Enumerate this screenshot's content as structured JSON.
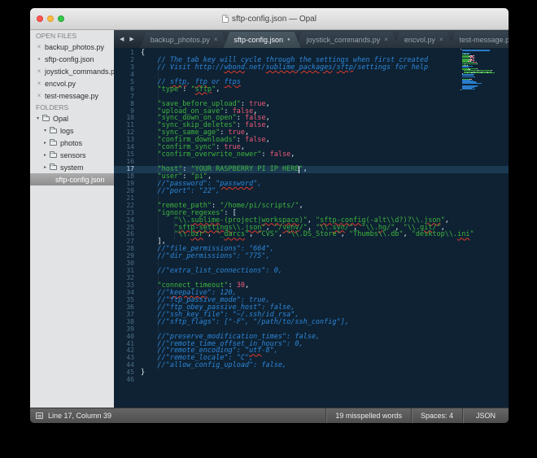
{
  "window": {
    "title": "sftp-config.json — Opal"
  },
  "icons": {
    "back": "◀",
    "forward": "▶",
    "overflow": "▼",
    "close": "×",
    "modified": "●",
    "expanded": "▾",
    "collapsed": "▸"
  },
  "sidebar": {
    "open_files_header": "OPEN FILES",
    "open_files": [
      {
        "name": "backup_photos.py",
        "modified": false
      },
      {
        "name": "sftp-config.json",
        "modified": true
      },
      {
        "name": "joystick_commands.py",
        "modified": false
      },
      {
        "name": "encvol.py",
        "modified": false
      },
      {
        "name": "test-message.py",
        "modified": false
      }
    ],
    "folders_header": "FOLDERS",
    "tree": [
      {
        "label": "Opal",
        "kind": "folder",
        "depth": 0,
        "expanded": true,
        "selected": false
      },
      {
        "label": "logs",
        "kind": "folder",
        "depth": 1,
        "expanded": true,
        "selected": false
      },
      {
        "label": "photos",
        "kind": "folder",
        "depth": 1,
        "expanded": false,
        "selected": false
      },
      {
        "label": "sensors",
        "kind": "folder",
        "depth": 1,
        "expanded": false,
        "selected": false
      },
      {
        "label": "system",
        "kind": "folder",
        "depth": 1,
        "expanded": false,
        "selected": false
      },
      {
        "label": "sftp-config.json",
        "kind": "file",
        "depth": 1,
        "expanded": false,
        "selected": true
      }
    ]
  },
  "tabs": [
    {
      "label": "backup_photos.py",
      "active": false,
      "modified": false
    },
    {
      "label": "sftp-config.json",
      "active": true,
      "modified": true
    },
    {
      "label": "joystick_commands.py",
      "active": false,
      "modified": false
    },
    {
      "label": "encvol.py",
      "active": false,
      "modified": false
    },
    {
      "label": "test-message.py",
      "active": false,
      "modified": false
    }
  ],
  "editor": {
    "active_line": 17,
    "cursor": {
      "line": 17,
      "column": 39
    },
    "lines": [
      [
        [
          "p",
          "{"
        ]
      ],
      [
        [
          "c",
          "    // The tab key will cycle through the settings when first created"
        ]
      ],
      [
        [
          "c",
          "    // Visit http://"
        ],
        [
          "cm",
          "wbond"
        ],
        [
          "c",
          ".net/"
        ],
        [
          "cm",
          "sublime_packages"
        ],
        [
          "c",
          "/"
        ],
        [
          "cm",
          "sftp"
        ],
        [
          "c",
          "/settings for help"
        ]
      ],
      [],
      [
        [
          "c",
          "    // "
        ],
        [
          "cm",
          "sftp"
        ],
        [
          "c",
          ", "
        ],
        [
          "cm",
          "ftp"
        ],
        [
          "c",
          " or "
        ],
        [
          "cm",
          "ftps"
        ]
      ],
      [
        [
          "p",
          "    "
        ],
        [
          "s",
          "\"type\""
        ],
        [
          "p",
          ": "
        ],
        [
          "s",
          "\""
        ],
        [
          "sm",
          "sftp"
        ],
        [
          "s",
          "\""
        ],
        [
          "p",
          ","
        ]
      ],
      [],
      [
        [
          "p",
          "    "
        ],
        [
          "s",
          "\"save_before_upload\""
        ],
        [
          "p",
          ": "
        ],
        [
          "v",
          "true"
        ],
        [
          "p",
          ","
        ]
      ],
      [
        [
          "p",
          "    "
        ],
        [
          "s",
          "\"upload_on_save\""
        ],
        [
          "p",
          ": "
        ],
        [
          "v",
          "false"
        ],
        [
          "p",
          ","
        ]
      ],
      [
        [
          "p",
          "    "
        ],
        [
          "s",
          "\"sync_down_on_open\""
        ],
        [
          "p",
          ": "
        ],
        [
          "v",
          "false"
        ],
        [
          "p",
          ","
        ]
      ],
      [
        [
          "p",
          "    "
        ],
        [
          "s",
          "\"sync_skip_deletes\""
        ],
        [
          "p",
          ": "
        ],
        [
          "v",
          "false"
        ],
        [
          "p",
          ","
        ]
      ],
      [
        [
          "p",
          "    "
        ],
        [
          "s",
          "\"sync_same_age\""
        ],
        [
          "p",
          ": "
        ],
        [
          "v",
          "true"
        ],
        [
          "p",
          ","
        ]
      ],
      [
        [
          "p",
          "    "
        ],
        [
          "s",
          "\"confirm_downloads\""
        ],
        [
          "p",
          ": "
        ],
        [
          "v",
          "false"
        ],
        [
          "p",
          ","
        ]
      ],
      [
        [
          "p",
          "    "
        ],
        [
          "s",
          "\"confirm_sync\""
        ],
        [
          "p",
          ": "
        ],
        [
          "v",
          "true"
        ],
        [
          "p",
          ","
        ]
      ],
      [
        [
          "p",
          "    "
        ],
        [
          "s",
          "\"confirm_overwrite_newer\""
        ],
        [
          "p",
          ": "
        ],
        [
          "v",
          "false"
        ],
        [
          "p",
          ","
        ]
      ],
      [],
      [
        [
          "p",
          "    "
        ],
        [
          "s",
          "\"host\""
        ],
        [
          "p",
          ": "
        ],
        [
          "s",
          "\"YOUR RASPBERRY PI IP HERE\""
        ],
        [
          "p",
          ","
        ]
      ],
      [
        [
          "p",
          "    "
        ],
        [
          "s",
          "\"user\""
        ],
        [
          "p",
          ": "
        ],
        [
          "s",
          "\"pi\""
        ],
        [
          "p",
          ","
        ]
      ],
      [
        [
          "c",
          "    //\"password\": \""
        ],
        [
          "cm",
          "password"
        ],
        [
          "c",
          "\","
        ]
      ],
      [
        [
          "c",
          "    //\"port\": \"22\","
        ]
      ],
      [],
      [
        [
          "p",
          "    "
        ],
        [
          "s",
          "\"remote_path\""
        ],
        [
          "p",
          ": "
        ],
        [
          "s",
          "\"/home/pi/scripts/\""
        ],
        [
          "p",
          ","
        ]
      ],
      [
        [
          "p",
          "    "
        ],
        [
          "s",
          "\"ignore_regexes\""
        ],
        [
          "p",
          ": ["
        ]
      ],
      [
        [
          "p",
          "        "
        ],
        [
          "s",
          "\"\\\\."
        ],
        [
          "sm",
          "sublime"
        ],
        [
          "s",
          "-(project|"
        ],
        [
          "sm",
          "workspace"
        ],
        [
          "s",
          ")\""
        ],
        [
          "p",
          ", "
        ],
        [
          "s",
          "\""
        ],
        [
          "sm",
          "sftp-config"
        ],
        [
          "s",
          "(-alt\\\\d?)?\\\\."
        ],
        [
          "sm",
          "json"
        ],
        [
          "s",
          "\""
        ],
        [
          "p",
          ","
        ]
      ],
      [
        [
          "p",
          "        "
        ],
        [
          "s",
          "\""
        ],
        [
          "sm",
          "sftp-settings"
        ],
        [
          "s",
          "\\\\."
        ],
        [
          "sm",
          "json"
        ],
        [
          "s",
          "\""
        ],
        [
          "p",
          ", "
        ],
        [
          "s",
          "\"/"
        ],
        [
          "sm",
          "venv"
        ],
        [
          "s",
          "/\""
        ],
        [
          "p",
          ", "
        ],
        [
          "s",
          "\"\\\\."
        ],
        [
          "sm",
          "svn"
        ],
        [
          "s",
          "/\""
        ],
        [
          "p",
          ", "
        ],
        [
          "s",
          "\"\\\\."
        ],
        [
          "sm",
          "hg"
        ],
        [
          "s",
          "/\""
        ],
        [
          "p",
          ", "
        ],
        [
          "s",
          "\"\\\\."
        ],
        [
          "sm",
          "git"
        ],
        [
          "s",
          "/\""
        ],
        [
          "p",
          ","
        ]
      ],
      [
        [
          "p",
          "        "
        ],
        [
          "s",
          "\"\\\\."
        ],
        [
          "sm",
          "bzr"
        ],
        [
          "s",
          "\""
        ],
        [
          "p",
          ", "
        ],
        [
          "s",
          "\"_"
        ],
        [
          "sm",
          "darcs"
        ],
        [
          "s",
          "\""
        ],
        [
          "p",
          ", "
        ],
        [
          "s",
          "\"CVS\""
        ],
        [
          "p",
          ", "
        ],
        [
          "s",
          "\"\\\\.DS_Store\""
        ],
        [
          "p",
          ", "
        ],
        [
          "s",
          "\"Thumbs\\\\.db\""
        ],
        [
          "p",
          ", "
        ],
        [
          "s",
          "\"desktop\\\\."
        ],
        [
          "sm",
          "ini"
        ],
        [
          "s",
          "\""
        ]
      ],
      [
        [
          "p",
          "    ],"
        ]
      ],
      [
        [
          "c",
          "    //\"file_permissions\": \"664\","
        ]
      ],
      [
        [
          "c",
          "    //\"dir_permissions\": \"775\","
        ]
      ],
      [],
      [
        [
          "c",
          "    //\"extra_list_connections\": 0,"
        ]
      ],
      [],
      [
        [
          "p",
          "    "
        ],
        [
          "s",
          "\"connect_timeout\""
        ],
        [
          "p",
          ": "
        ],
        [
          "v",
          "30"
        ],
        [
          "p",
          ","
        ]
      ],
      [
        [
          "c",
          "    //\""
        ],
        [
          "cm",
          "keepalive"
        ],
        [
          "c",
          "\": 120,"
        ]
      ],
      [
        [
          "c",
          "    //\"ftp_passive_mode\": true,"
        ]
      ],
      [
        [
          "c",
          "    //\"ftp_obey_passive_host\": false,"
        ]
      ],
      [
        [
          "c",
          "    //\"ssh_key_file\": \"~/.ssh/id_rsa\","
        ]
      ],
      [
        [
          "c",
          "    //\"sftp_flags\": [\"-F\", \"/path/to/ssh_config\"],"
        ]
      ],
      [],
      [
        [
          "c",
          "    //\"preserve_modification_times\": false,"
        ]
      ],
      [
        [
          "c",
          "    //\"remote_time_offset_in_hours\": 0,"
        ]
      ],
      [
        [
          "c",
          "    //\"remote_encoding\": \""
        ],
        [
          "cm",
          "utf"
        ],
        [
          "c",
          "-8\","
        ]
      ],
      [
        [
          "c",
          "    //\"remote_locale\": \"C\","
        ]
      ],
      [
        [
          "c",
          "    //\"allow_config_upload\": false,"
        ]
      ],
      [
        [
          "p",
          "}"
        ]
      ],
      []
    ]
  },
  "status_bar": {
    "position": "Line 17, Column 39",
    "misspelled": "19 misspelled words",
    "spaces": "Spaces: 4",
    "syntax": "JSON"
  },
  "colors": {
    "editor_bg": "#0E2233",
    "line_highlight": "#1B3A52",
    "gutter_text": "#4D6C85",
    "comment": "#2E86D9",
    "string": "#3FB33F",
    "constant": "#EE5A77",
    "plain": "#E3ECF4",
    "misspell_underline": "#E0392E",
    "caret": "#FFFFFF",
    "sidebar_bg": "#E2E3E4",
    "tab_active_text": "#F1F5F9",
    "statusbar_text": "#EBEBEB"
  }
}
